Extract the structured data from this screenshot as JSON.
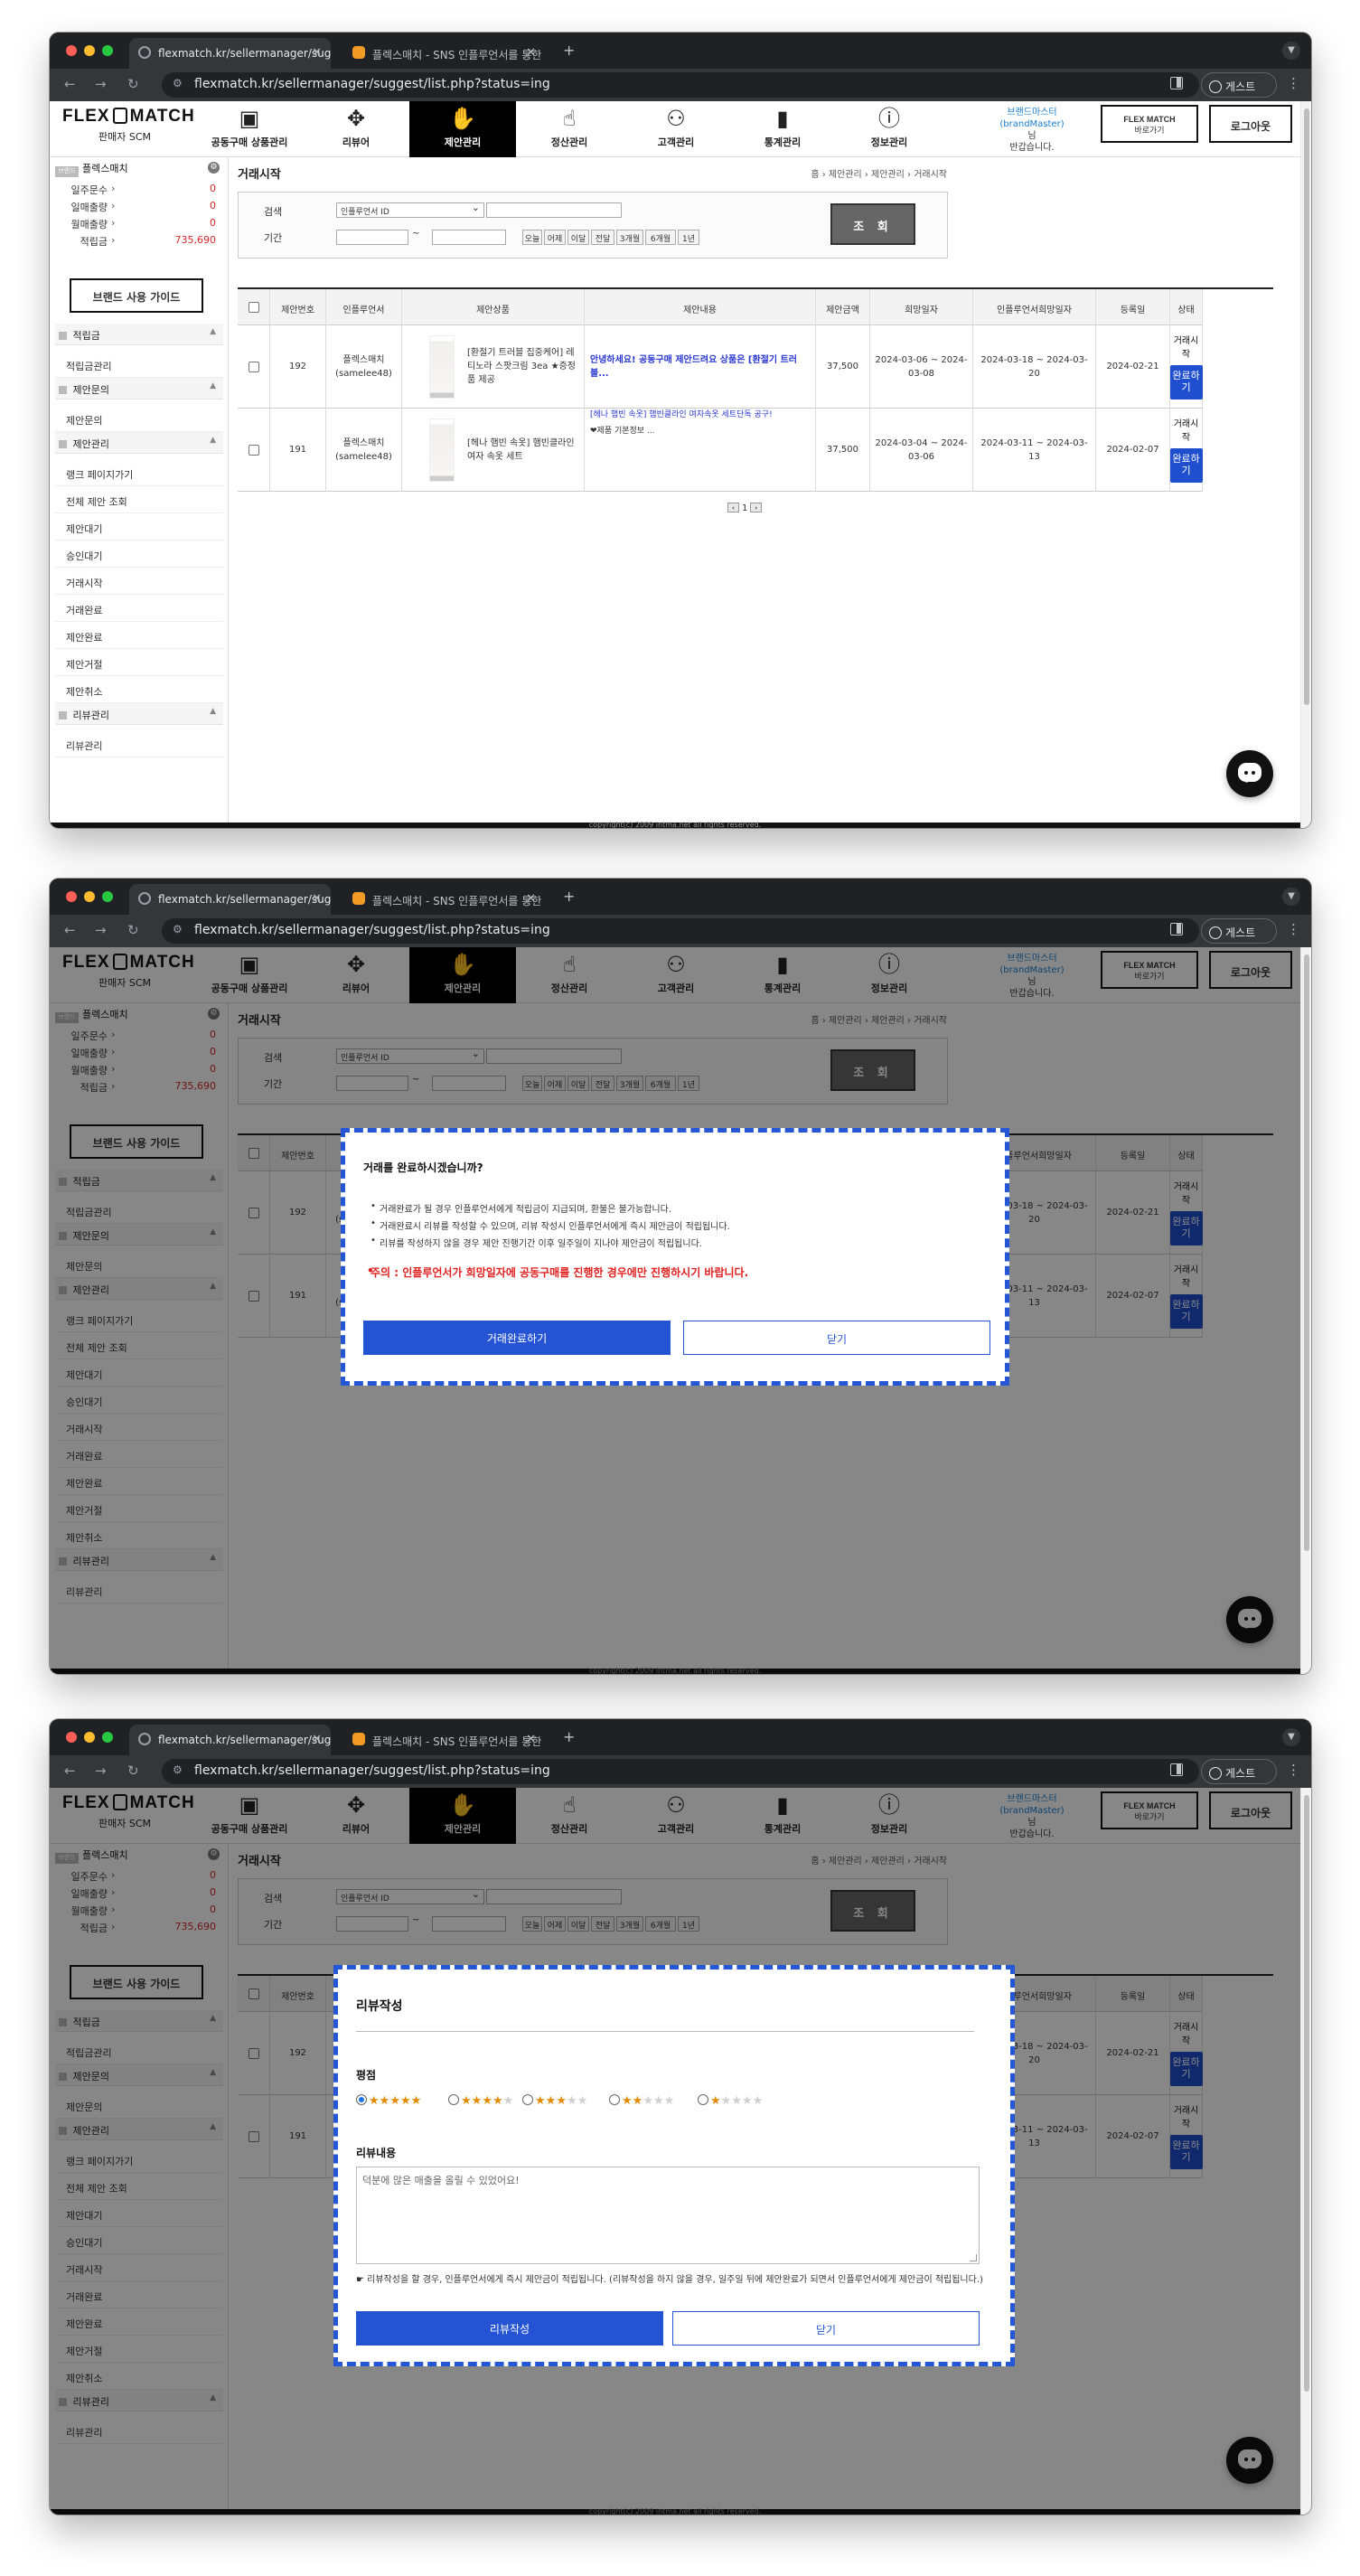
{
  "browser": {
    "tab1": "flexmatch.kr/sellermanager/suggest/list.php?status=ing",
    "tab2": "플렉스매치 - SNS 인플루언서를 통한",
    "url": "flexmatch.kr/sellermanager/suggest/list.php?status=ing",
    "profile": "게스트"
  },
  "header": {
    "logo": "FLEX MATCH",
    "subtitle": "판매자 SCM",
    "menus": [
      "공동구매 상품관리",
      "리뷰어",
      "제안관리",
      "정산관리",
      "고객관리",
      "통계관리",
      "정보관리"
    ],
    "menu_icons": [
      "box-icon",
      "reviewer-icon",
      "proposal-icon",
      "settlement-icon",
      "customers-icon",
      "stats-icon",
      "info-icon"
    ],
    "active_menu": "제안관리",
    "brand_name": "브랜드마스터",
    "brand_id": "(brandMaster)",
    "brand_suffix": "님",
    "greeting": "반갑습니다.",
    "fm_logo": "FLEX MATCH",
    "fm_shortcut": "바로가기",
    "logout": "로그아웃"
  },
  "sidebar": {
    "brand_badge": "브랜드",
    "brand": "플렉스매치",
    "stats": [
      {
        "label": "일주문수",
        "value": "0"
      },
      {
        "label": "일매출량",
        "value": "0"
      },
      {
        "label": "월매출량",
        "value": "0"
      },
      {
        "label": "적립금",
        "value": "735,690"
      }
    ],
    "guide_button": "브랜드 사용 가이드",
    "sections": [
      {
        "title": "적립금",
        "items": [
          "적립금관리"
        ]
      },
      {
        "title": "제안문의",
        "items": [
          "제안문의"
        ]
      },
      {
        "title": "제안관리",
        "items": [
          "랭크 페이지가기",
          "전체 제안 조회",
          "제안대기",
          "승인대기",
          "거래시작",
          "거래완료",
          "제안완료",
          "제안거절",
          "제안취소"
        ]
      },
      {
        "title": "리뷰관리",
        "items": [
          "리뷰관리"
        ]
      }
    ]
  },
  "page": {
    "title": "거래시작",
    "breadcrumb": "홈 › 제안관리 › 제안관리 › 거래시작",
    "search_label": "검색",
    "search_select": "인플루언서 ID",
    "period_label": "기간",
    "tilde": "~",
    "date_buttons": [
      "오늘",
      "어제",
      "이달",
      "전달",
      "3개월",
      "6개월",
      "1년"
    ],
    "search_button": "조 회"
  },
  "table": {
    "headers": [
      "",
      "제안번호",
      "인플루언서",
      "제안상품",
      "제안내용",
      "제안금액",
      "희망일자",
      "인플루언서희망일자",
      "등록일",
      "상태"
    ],
    "rows": [
      {
        "id": "192",
        "influencer": "플렉스매치 (samelee48)",
        "product": "[환절기 트러블 집중케어] 레티노라 스팟크림 3ea ★증정품 제공",
        "note": "안녕하세요! 공동구매 제안드려요 상품은 [환절기 트러블...",
        "note_extra": "",
        "amount": "37,500",
        "wish": "2024-03-06 ~ 2024-03-08",
        "inf_wish": "2024-03-18 ~ 2024-03-20",
        "registered": "2024-02-21",
        "status": "거래시작",
        "action": "완료하기"
      },
      {
        "id": "191",
        "influencer": "플렉스매치 (samelee48)",
        "product": "[헤나 햄빈 속옷] 햄빈클라인 여자 속옷 세트",
        "note": "[헤나 햄빈 속옷] 햄빈클라인 여자속옷 세트단독 공구!",
        "note_extra": "❤제품 기본정보 ...",
        "amount": "37,500",
        "wish": "2024-03-04 ~ 2024-03-06",
        "inf_wish": "2024-03-11 ~ 2024-03-13",
        "registered": "2024-02-07",
        "status": "거래시작",
        "action": "완료하기"
      }
    ],
    "pager": {
      "prev": "‹",
      "page": "1",
      "next": "›"
    }
  },
  "footer": "copyright(c) 2009 intma.net all rights reserved.",
  "complete_modal": {
    "title": "거래를 완료하시겠습니까?",
    "lines": [
      "거래완료가 될 경우 인플루언서에게 적립금이 지급되며, 환불은 불가능합니다.",
      "거래완료시 리뷰를 작성할 수 있으며, 리뷰 작성시 인플루언서에게 즉시 제안금이 적립됩니다.",
      "리뷰를 작성하지 않을 경우 제안 진행기간 이후 일주일이 지나야 제안금이 적립됩니다."
    ],
    "warning": "주의 : 인플루언서가 희망일자에 공동구매를 진행한 경우에만 진행하시기 바랍니다.",
    "confirm": "거래완료하기",
    "close": "닫기"
  },
  "review_modal": {
    "title": "리뷰작성",
    "rating_label": "평점",
    "ratings": [
      5,
      4,
      3,
      2,
      1
    ],
    "selected_rating": 5,
    "content_label": "리뷰내용",
    "content": "덕분에 많은 매출을 올릴 수 있었어요!",
    "notice": "☛ 리뷰작성을 할 경우, 인플루언서에게 즉시 제안금이 적립됩니다. (리뷰작성을 하지 않을 경우, 일주일 뒤에 제안완료가 되면서 인플루언서에게 제안금이 적립됩니다.)",
    "submit": "리뷰작성",
    "close": "닫기"
  },
  "colors": {
    "accent": "#2454d4",
    "modal_border": "#2456d6",
    "warning": "#e01f1f",
    "stat_value": "#d62828",
    "star": "#e38b00"
  }
}
